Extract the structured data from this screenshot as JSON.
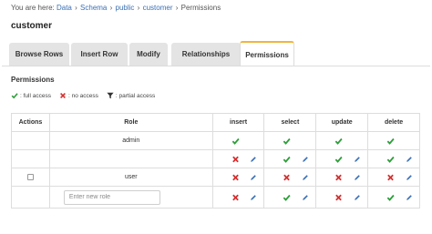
{
  "breadcrumb": {
    "prefix": "You are here:",
    "items": [
      "Data",
      "Schema",
      "public",
      "customer",
      "Permissions"
    ],
    "separator": "›"
  },
  "page_title": "customer",
  "tabs": [
    {
      "label": "Browse Rows",
      "active": false
    },
    {
      "label": "Insert Row",
      "active": false
    },
    {
      "label": "Modify",
      "active": false
    },
    {
      "label": "Relationships",
      "active": false
    },
    {
      "label": "Permissions",
      "active": true
    }
  ],
  "permissions": {
    "heading": "Permissions",
    "legend": [
      {
        "icon": "check-icon",
        "label": ": full access"
      },
      {
        "icon": "cross-icon",
        "label": ": no access"
      },
      {
        "icon": "filter-icon",
        "label": ": partial access"
      }
    ],
    "columns": [
      "Actions",
      "Role",
      "insert",
      "select",
      "update",
      "delete"
    ],
    "rows": [
      {
        "role": "admin",
        "checkbox": false,
        "editable": false,
        "cells": [
          "full",
          "full",
          "full",
          "full"
        ]
      },
      {
        "role": "",
        "checkbox": false,
        "editable": true,
        "cells": [
          "none",
          "full",
          "full",
          "full"
        ]
      },
      {
        "role": "user",
        "checkbox": true,
        "editable": true,
        "cells": [
          "none",
          "none",
          "none",
          "none"
        ]
      },
      {
        "role": "",
        "checkbox": false,
        "editable": true,
        "input_placeholder": "Enter new role",
        "cells": [
          "none",
          "full",
          "none",
          "full"
        ]
      }
    ]
  },
  "colors": {
    "full_access": "#2e9e3a",
    "no_access": "#d32f2f",
    "edit_icon": "#3a6fb5",
    "active_tab_accent": "#f0b53d",
    "link": "#3a6fb5"
  }
}
